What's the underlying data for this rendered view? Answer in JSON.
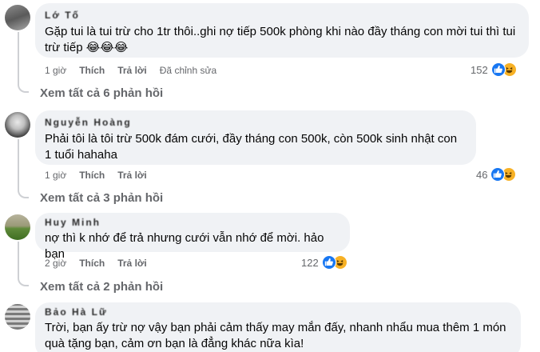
{
  "comments": [
    {
      "author": "Lớ Tố",
      "text": "Gặp tui là tui trừ cho 1tr thôi..ghi nợ tiếp 500k phòng khi nào đầy tháng con mời tui thì tui trừ tiếp 😂😂😂",
      "time": "1 giờ",
      "like_label": "Thích",
      "reply_label": "Trả lời",
      "edited_label": "Đã chỉnh sửa",
      "reaction_count": "152",
      "view_replies": "Xem tất cả 6 phản hồi"
    },
    {
      "author": "Nguyễn Hoàng",
      "text": "Phải tôi là tôi trừ 500k đám cưới, đầy tháng con 500k, còn 500k sinh nhật con 1 tuổi hahaha",
      "time": "1 giờ",
      "like_label": "Thích",
      "reply_label": "Trả lời",
      "reaction_count": "46",
      "view_replies": "Xem tất cả 3 phản hồi"
    },
    {
      "author": "Huy Minh",
      "text": "nợ thì k nhớ để trả nhưng cưới vẫn nhớ để mời. hảo bạn",
      "time": "2 giờ",
      "like_label": "Thích",
      "reply_label": "Trả lời",
      "reaction_count": "122",
      "view_replies": "Xem tất cả 2 phản hồi"
    },
    {
      "author": "Bảo Hà Lữ",
      "text": "Trời, bạn ấy trừ nợ vậy bạn phải cảm thấy may mắn đấy, nhanh nhẩu mua thêm 1 món quà tặng bạn, cảm ơn bạn là đẳng khác nữa kìa!"
    }
  ],
  "colors": {
    "bubble": "#f0f2f5",
    "secondary_text": "#65676b",
    "like_blue": "#1877f2",
    "haha_yellow": "#f7b125"
  },
  "icons": [
    "like-icon",
    "haha-icon",
    "reply-arrow-icon"
  ]
}
